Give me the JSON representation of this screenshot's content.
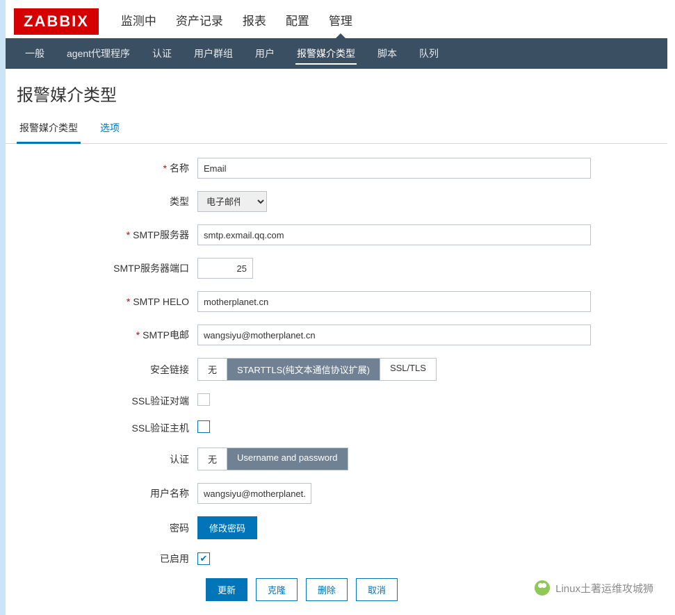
{
  "brand": "ZABBIX",
  "topnav": {
    "items": [
      "监测中",
      "资产记录",
      "报表",
      "配置",
      "管理"
    ],
    "active_index": 4
  },
  "subnav": {
    "items": [
      "一般",
      "agent代理程序",
      "认证",
      "用户群组",
      "用户",
      "报警媒介类型",
      "脚本",
      "队列"
    ],
    "active_index": 5
  },
  "page_title": "报警媒介类型",
  "tabs": {
    "items": [
      "报警媒介类型",
      "选项"
    ],
    "active_index": 0
  },
  "form": {
    "name_label": "名称",
    "name_value": "Email",
    "type_label": "类型",
    "type_value": "电子邮件",
    "smtp_server_label": "SMTP服务器",
    "smtp_server_value": "smtp.exmail.qq.com",
    "smtp_port_label": "SMTP服务器端口",
    "smtp_port_value": "25",
    "smtp_helo_label": "SMTP HELO",
    "smtp_helo_value": "motherplanet.cn",
    "smtp_email_label": "SMTP电邮",
    "smtp_email_value": "wangsiyu@motherplanet.cn",
    "security_label": "安全链接",
    "security_options": [
      "无",
      "STARTTLS(纯文本通信协议扩展)",
      "SSL/TLS"
    ],
    "security_active_index": 1,
    "ssl_peer_label": "SSL验证对端",
    "ssl_peer_checked": false,
    "ssl_host_label": "SSL验证主机",
    "ssl_host_checked": false,
    "auth_label": "认证",
    "auth_options": [
      "无",
      "Username and password"
    ],
    "auth_active_index": 1,
    "username_label": "用户名称",
    "username_value": "wangsiyu@motherplanet.cn",
    "password_label": "密码",
    "password_btn": "修改密码",
    "enabled_label": "已启用",
    "enabled_checked": true
  },
  "actions": {
    "update": "更新",
    "clone": "克隆",
    "delete": "删除",
    "cancel": "取消"
  },
  "watermark": "Linux土著运维攻城狮"
}
